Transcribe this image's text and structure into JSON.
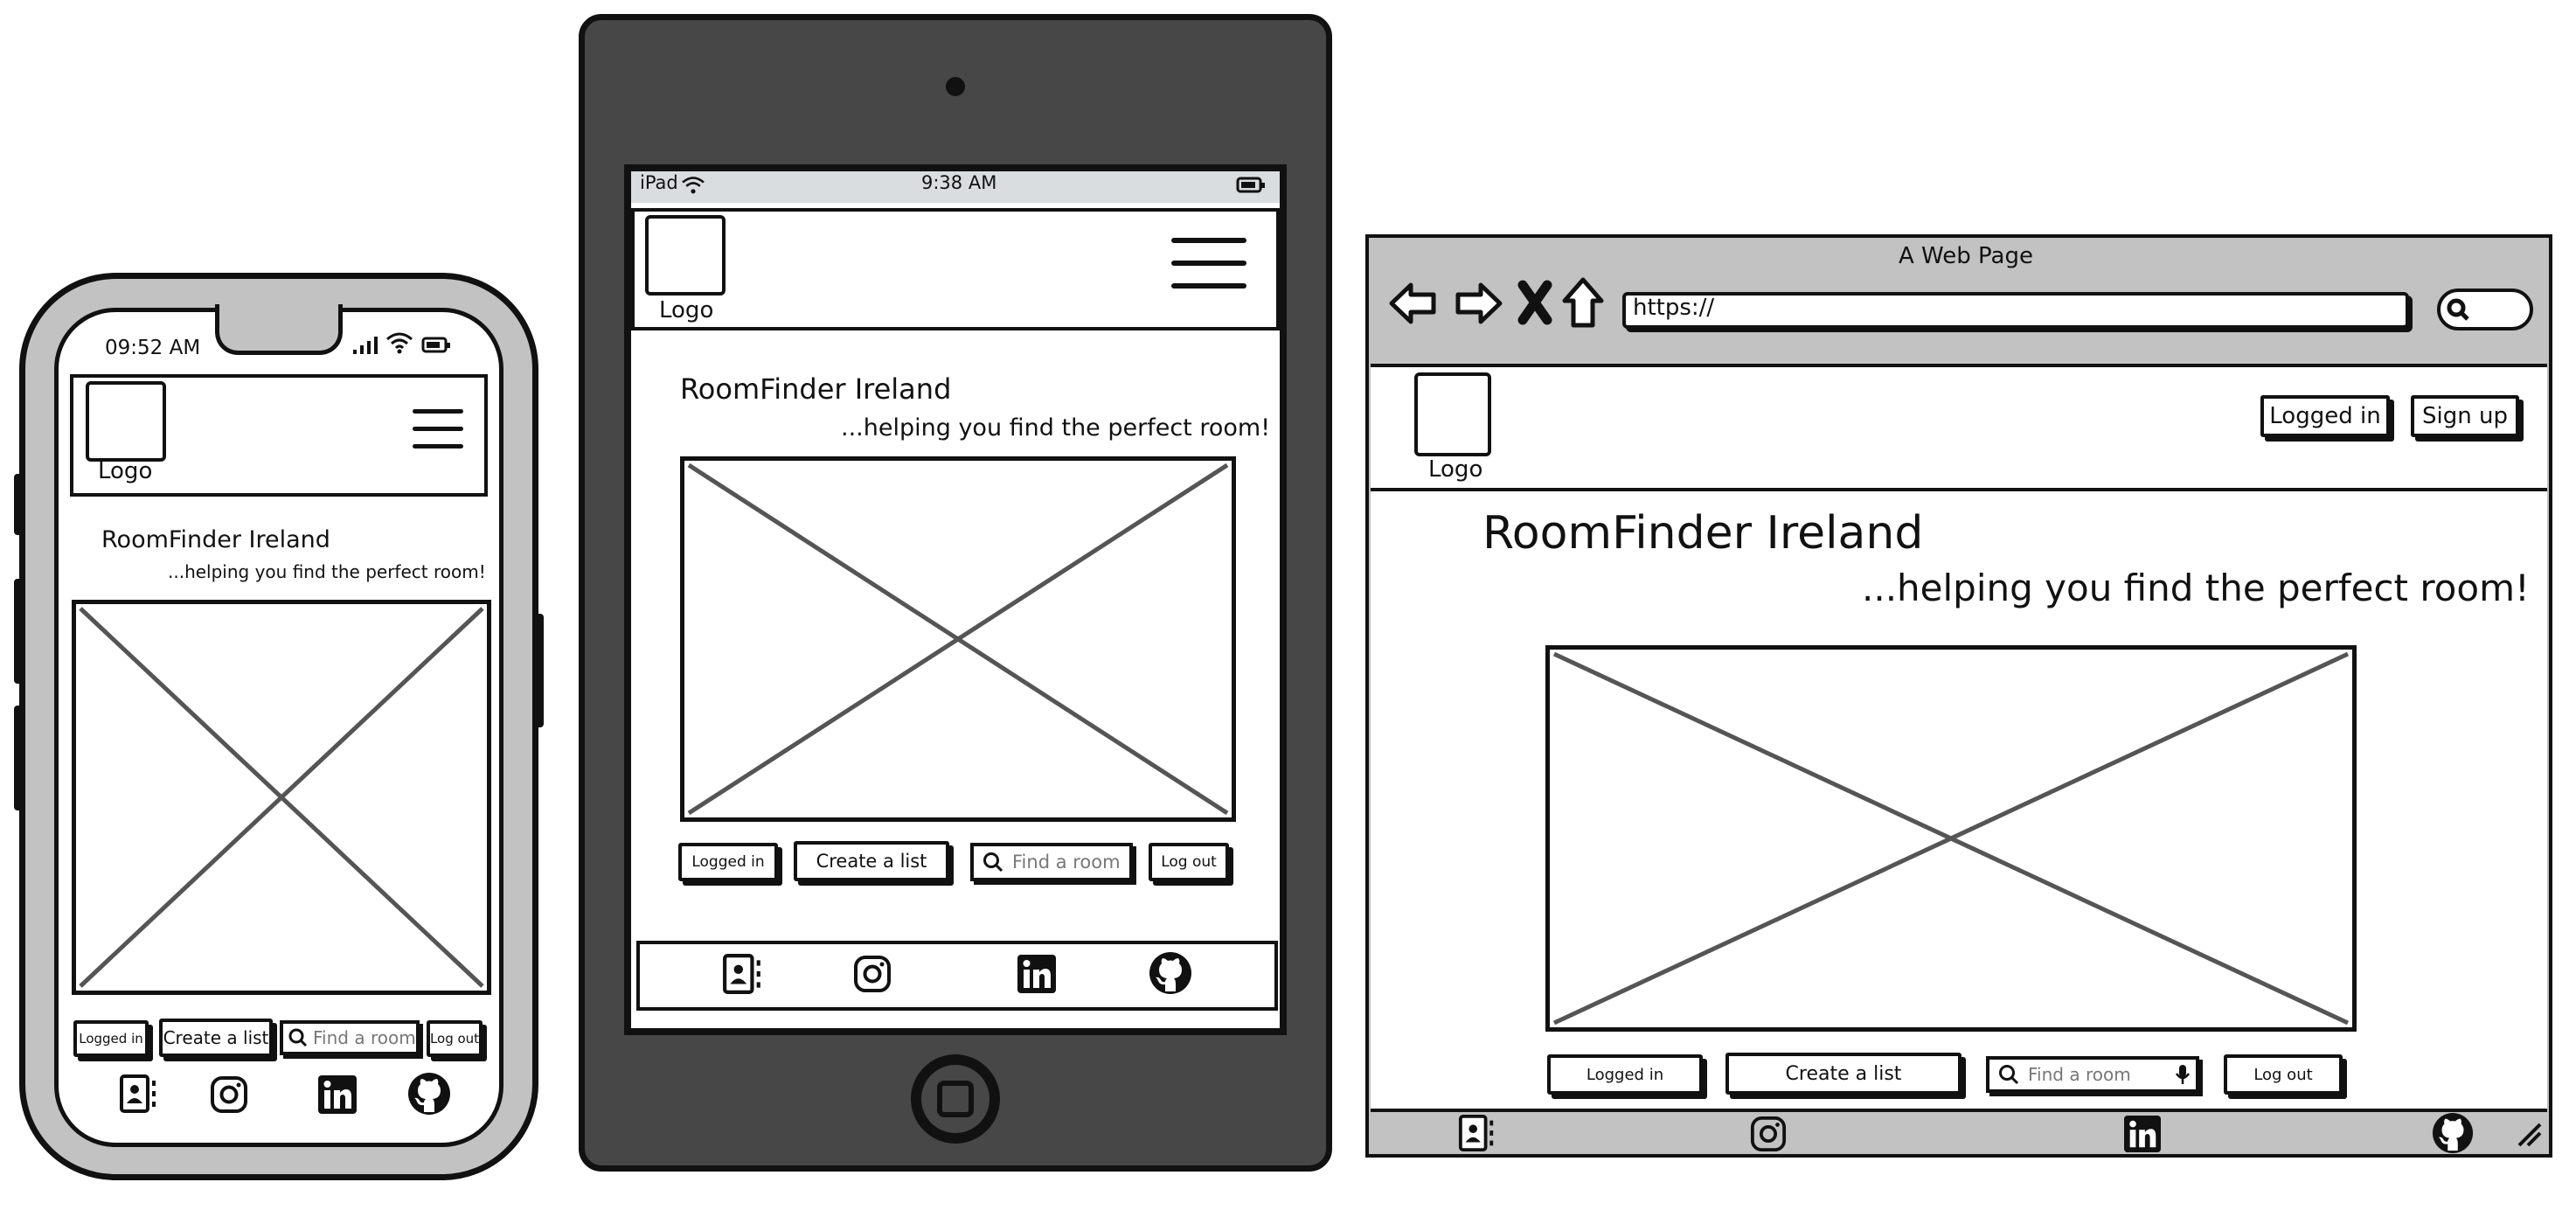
{
  "phone": {
    "status_time": "09:52 AM",
    "logo_label": "Logo",
    "title": "RoomFinder Ireland",
    "tagline": "...helping you find the perfect room!",
    "buttons": {
      "logged_in": "Logged in",
      "create_list": "Create a list",
      "log_out": "Log out"
    },
    "search_placeholder": "Find a room"
  },
  "tablet": {
    "status_device": "iPad",
    "status_time": "9:38 AM",
    "logo_label": "Logo",
    "title": "RoomFinder Ireland",
    "tagline": "...helping you find the perfect room!",
    "buttons": {
      "logged_in": "Logged in",
      "create_list": "Create a list",
      "log_out": "Log out"
    },
    "search_placeholder": "Find a room"
  },
  "browser": {
    "window_title": "A Web Page",
    "url": "https://",
    "logo_label": "Logo",
    "header_buttons": {
      "logged_in": "Logged in",
      "sign_up": "Sign up"
    },
    "title": "RoomFinder Ireland",
    "tagline": "...helping you find the perfect room!",
    "buttons": {
      "logged_in": "Logged in",
      "create_list": "Create a list",
      "log_out": "Log out"
    },
    "search_placeholder": "Find a room"
  },
  "footer_icons": [
    "contact-card-icon",
    "instagram-icon",
    "linkedin-icon",
    "github-icon"
  ],
  "colors": {
    "device_gray": "#c2c2c2",
    "tablet_body": "#474747",
    "ink": "#111111",
    "status_bar": "#d9dde0"
  }
}
